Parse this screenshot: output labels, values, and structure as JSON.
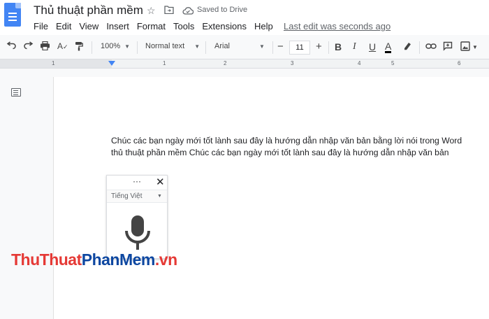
{
  "doc": {
    "title": "Thủ thuật phần mềm",
    "saved_status": "Saved to Drive",
    "last_edit": "Last edit was seconds ago"
  },
  "menu": {
    "items": [
      "File",
      "Edit",
      "View",
      "Insert",
      "Format",
      "Tools",
      "Extensions",
      "Help"
    ]
  },
  "toolbar": {
    "zoom": "100%",
    "style": "Normal text",
    "font": "Arial",
    "font_size": "11",
    "minus": "−",
    "plus": "+",
    "bold": "B",
    "italic": "I",
    "underline": "U",
    "text_color": "A"
  },
  "ruler": {
    "labels": [
      "1",
      "1",
      "2",
      "3",
      "4",
      "5",
      "6"
    ]
  },
  "content": {
    "line1": "Chúc các bạn ngày mới tốt lành sau đây là hướng dẫn nhập văn bản bằng lời nói trong Word",
    "line2": "thủ thuật phần mềm Chúc các bạn ngày mới tốt lành sau đây là hướng dẫn nhập văn bản"
  },
  "voice_typing": {
    "menu_dots": "···",
    "close": "✕",
    "language": "Tiếng Việt"
  },
  "watermark": {
    "part1": "ThuThuat",
    "part2": "PhanMem",
    "part3": ".vn"
  },
  "colors": {
    "docs_blue": "#4285f4",
    "watermark_red": "#e53935",
    "watermark_blue": "#0d47a1"
  }
}
